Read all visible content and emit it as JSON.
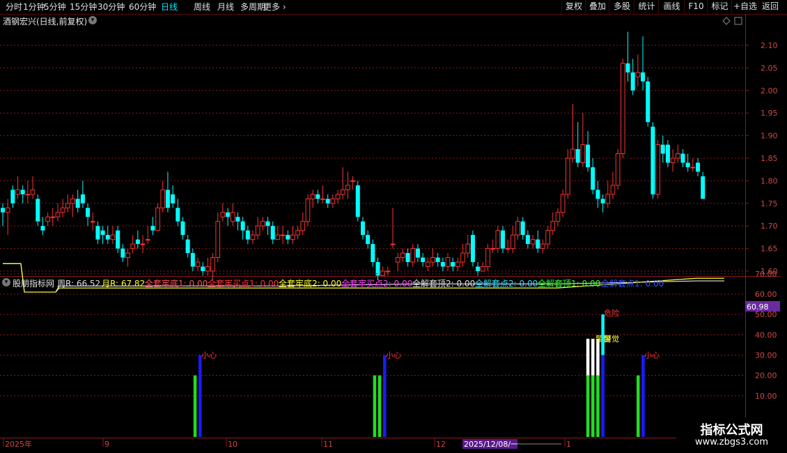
{
  "toolbar": {
    "timeframes": [
      "分时",
      "1分钟",
      "5分钟",
      "15分钟",
      "30分钟",
      "60分钟",
      "日线",
      "周线",
      "月线",
      "多周期",
      "更多"
    ],
    "active_timeframe": "日线",
    "right_buttons": [
      "复权",
      "叠加",
      "多股",
      "统计",
      "画线",
      "F10",
      "标记",
      "+自选",
      "返回"
    ]
  },
  "stock": {
    "title": "酒钢宏兴(日线,前复权)"
  },
  "price_axis": {
    "ticks": [
      "2.10",
      "2.05",
      "2.00",
      "1.95",
      "1.90",
      "1.85",
      "1.80",
      "1.75",
      "1.70",
      "1.65",
      "1.60"
    ]
  },
  "indicator": {
    "name": "股朋指标网",
    "items": [
      {
        "label": "周R: 66.52",
        "color": "#e0e0e0"
      },
      {
        "label": "月R: 67.82",
        "color": "#ffff33"
      },
      {
        "label": "全套牢底1: 0.00",
        "color": "#ff5555"
      },
      {
        "label": "全套牢买点1: 0.00",
        "color": "#ff3333"
      },
      {
        "label": "全套牢底2: 0.00",
        "color": "#ffff33"
      },
      {
        "label": "全套牢买点2: 0.00",
        "color": "#ff44ff"
      },
      {
        "label": "全解套顶2: 0.00",
        "color": "#e0e0e0"
      },
      {
        "label": "全解套点2: 0.00",
        "color": "#33ddff"
      },
      {
        "label": "全解套顶1: 0.00",
        "color": "#33ff33"
      },
      {
        "label": "全解套点1: 0.00",
        "color": "#3355ff"
      }
    ],
    "axis_ticks": [
      "70.00",
      "60.00",
      "50.00",
      "40.00",
      "30.00",
      "20.00",
      "10.00"
    ],
    "current_value": "60.98",
    "labels": {
      "careful": "小心",
      "danger": "危险",
      "alert": "警惕",
      "watch": "警觉"
    }
  },
  "date_axis": {
    "labels": [
      "2025年",
      "9",
      "10",
      "11",
      "12",
      "1"
    ],
    "cursor_date": "2025/12/08/一"
  },
  "watermark": {
    "logo": "指标公式网",
    "url": "www.zbgs3.com"
  },
  "colors": {
    "up": "#ff3333",
    "down": "#00ffff",
    "grid": "#8b1a1a",
    "bg": "#000000"
  },
  "chart_data": {
    "type": "candlestick",
    "price_range": [
      1.57,
      2.15
    ],
    "candles": [
      [
        1.74,
        1.73,
        1.75,
        1.7
      ],
      [
        1.73,
        1.74,
        1.76,
        1.68
      ],
      [
        1.78,
        1.75,
        1.79,
        1.74
      ],
      [
        1.77,
        1.78,
        1.81,
        1.76
      ],
      [
        1.78,
        1.77,
        1.79,
        1.75
      ],
      [
        1.77,
        1.77,
        1.8,
        1.75
      ],
      [
        1.77,
        1.78,
        1.81,
        1.76
      ],
      [
        1.76,
        1.71,
        1.77,
        1.7
      ],
      [
        1.7,
        1.69,
        1.72,
        1.68
      ],
      [
        1.71,
        1.72,
        1.73,
        1.7
      ],
      [
        1.72,
        1.72,
        1.74,
        1.7
      ],
      [
        1.72,
        1.73,
        1.75,
        1.71
      ],
      [
        1.73,
        1.74,
        1.76,
        1.72
      ],
      [
        1.74,
        1.75,
        1.77,
        1.73
      ],
      [
        1.75,
        1.76,
        1.77,
        1.72
      ],
      [
        1.76,
        1.74,
        1.78,
        1.73
      ],
      [
        1.77,
        1.75,
        1.8,
        1.74
      ],
      [
        1.74,
        1.72,
        1.75,
        1.7
      ],
      [
        1.71,
        1.71,
        1.73,
        1.69
      ],
      [
        1.7,
        1.67,
        1.71,
        1.66
      ],
      [
        1.69,
        1.68,
        1.7,
        1.66
      ],
      [
        1.68,
        1.67,
        1.7,
        1.66
      ],
      [
        1.67,
        1.68,
        1.7,
        1.66
      ],
      [
        1.69,
        1.65,
        1.7,
        1.64
      ],
      [
        1.65,
        1.63,
        1.66,
        1.62
      ],
      [
        1.63,
        1.64,
        1.65,
        1.61
      ],
      [
        1.65,
        1.66,
        1.68,
        1.64
      ],
      [
        1.67,
        1.66,
        1.69,
        1.65
      ],
      [
        1.66,
        1.66,
        1.68,
        1.64
      ],
      [
        1.67,
        1.67,
        1.7,
        1.66
      ],
      [
        1.7,
        1.69,
        1.72,
        1.68
      ],
      [
        1.69,
        1.74,
        1.75,
        1.69
      ],
      [
        1.74,
        1.78,
        1.8,
        1.73
      ],
      [
        1.78,
        1.74,
        1.82,
        1.73
      ],
      [
        1.77,
        1.75,
        1.79,
        1.74
      ],
      [
        1.74,
        1.71,
        1.76,
        1.7
      ],
      [
        1.71,
        1.68,
        1.72,
        1.67
      ],
      [
        1.67,
        1.64,
        1.68,
        1.63
      ],
      [
        1.64,
        1.61,
        1.65,
        1.6
      ],
      [
        1.61,
        1.62,
        1.63,
        1.6
      ],
      [
        1.61,
        1.6,
        1.62,
        1.59
      ],
      [
        1.6,
        1.61,
        1.63,
        1.59
      ],
      [
        1.6,
        1.63,
        1.64,
        1.58
      ],
      [
        1.63,
        1.71,
        1.73,
        1.62
      ],
      [
        1.72,
        1.73,
        1.75,
        1.71
      ],
      [
        1.73,
        1.72,
        1.74,
        1.7
      ],
      [
        1.71,
        1.73,
        1.75,
        1.7
      ],
      [
        1.72,
        1.71,
        1.73,
        1.69
      ],
      [
        1.71,
        1.69,
        1.72,
        1.67
      ],
      [
        1.69,
        1.67,
        1.7,
        1.66
      ],
      [
        1.67,
        1.68,
        1.69,
        1.66
      ],
      [
        1.68,
        1.7,
        1.72,
        1.67
      ],
      [
        1.7,
        1.71,
        1.72,
        1.69
      ],
      [
        1.71,
        1.7,
        1.72,
        1.68
      ],
      [
        1.7,
        1.67,
        1.71,
        1.66
      ],
      [
        1.67,
        1.68,
        1.7,
        1.67
      ],
      [
        1.68,
        1.68,
        1.7,
        1.66
      ],
      [
        1.68,
        1.67,
        1.69,
        1.66
      ],
      [
        1.67,
        1.68,
        1.7,
        1.66
      ],
      [
        1.68,
        1.69,
        1.7,
        1.67
      ],
      [
        1.69,
        1.71,
        1.73,
        1.68
      ],
      [
        1.71,
        1.76,
        1.77,
        1.7
      ],
      [
        1.76,
        1.77,
        1.78,
        1.74
      ],
      [
        1.77,
        1.76,
        1.78,
        1.75
      ],
      [
        1.76,
        1.76,
        1.79,
        1.75
      ],
      [
        1.76,
        1.75,
        1.77,
        1.74
      ],
      [
        1.75,
        1.76,
        1.77,
        1.74
      ],
      [
        1.76,
        1.77,
        1.78,
        1.75
      ],
      [
        1.77,
        1.78,
        1.83,
        1.76
      ],
      [
        1.78,
        1.79,
        1.82,
        1.76
      ],
      [
        1.8,
        1.8,
        1.81,
        1.78
      ],
      [
        1.79,
        1.72,
        1.8,
        1.71
      ],
      [
        1.71,
        1.68,
        1.72,
        1.67
      ],
      [
        1.68,
        1.66,
        1.69,
        1.65
      ],
      [
        1.66,
        1.62,
        1.67,
        1.61
      ],
      [
        1.62,
        1.59,
        1.63,
        1.58
      ],
      [
        1.59,
        1.6,
        1.61,
        1.59
      ],
      [
        1.6,
        1.6,
        1.61,
        1.59
      ],
      [
        1.66,
        1.66,
        1.74,
        1.65
      ],
      [
        1.62,
        1.63,
        1.64,
        1.6
      ],
      [
        1.63,
        1.64,
        1.65,
        1.62
      ],
      [
        1.64,
        1.62,
        1.65,
        1.61
      ],
      [
        1.62,
        1.65,
        1.66,
        1.61
      ],
      [
        1.65,
        1.63,
        1.66,
        1.62
      ],
      [
        1.63,
        1.62,
        1.64,
        1.61
      ],
      [
        1.61,
        1.62,
        1.63,
        1.6
      ],
      [
        1.62,
        1.63,
        1.65,
        1.61
      ],
      [
        1.63,
        1.62,
        1.64,
        1.61
      ],
      [
        1.62,
        1.61,
        1.63,
        1.6
      ],
      [
        1.61,
        1.63,
        1.64,
        1.6
      ],
      [
        1.62,
        1.61,
        1.63,
        1.6
      ],
      [
        1.61,
        1.62,
        1.63,
        1.6
      ],
      [
        1.62,
        1.64,
        1.66,
        1.61
      ],
      [
        1.64,
        1.66,
        1.68,
        1.63
      ],
      [
        1.68,
        1.62,
        1.69,
        1.61
      ],
      [
        1.61,
        1.6,
        1.62,
        1.59
      ],
      [
        1.6,
        1.61,
        1.62,
        1.6
      ],
      [
        1.61,
        1.65,
        1.66,
        1.6
      ],
      [
        1.65,
        1.65,
        1.67,
        1.64
      ],
      [
        1.65,
        1.69,
        1.7,
        1.64
      ],
      [
        1.69,
        1.65,
        1.7,
        1.64
      ],
      [
        1.65,
        1.65,
        1.67,
        1.64
      ],
      [
        1.65,
        1.68,
        1.7,
        1.64
      ],
      [
        1.68,
        1.71,
        1.72,
        1.67
      ],
      [
        1.71,
        1.68,
        1.72,
        1.67
      ],
      [
        1.68,
        1.66,
        1.69,
        1.65
      ],
      [
        1.66,
        1.67,
        1.68,
        1.65
      ],
      [
        1.67,
        1.65,
        1.69,
        1.64
      ],
      [
        1.65,
        1.66,
        1.67,
        1.64
      ],
      [
        1.66,
        1.69,
        1.7,
        1.65
      ],
      [
        1.69,
        1.71,
        1.73,
        1.68
      ],
      [
        1.71,
        1.73,
        1.74,
        1.7
      ],
      [
        1.73,
        1.77,
        1.78,
        1.72
      ],
      [
        1.77,
        1.85,
        1.87,
        1.76
      ],
      [
        1.85,
        1.87,
        1.97,
        1.84
      ],
      [
        1.87,
        1.84,
        1.93,
        1.83
      ],
      [
        1.84,
        1.88,
        1.95,
        1.83
      ],
      [
        1.88,
        1.83,
        1.91,
        1.82
      ],
      [
        1.83,
        1.78,
        1.85,
        1.77
      ],
      [
        1.78,
        1.76,
        1.8,
        1.74
      ],
      [
        1.76,
        1.75,
        1.77,
        1.73
      ],
      [
        1.75,
        1.77,
        1.8,
        1.74
      ],
      [
        1.77,
        1.79,
        1.82,
        1.76
      ],
      [
        1.79,
        1.86,
        1.87,
        1.78
      ],
      [
        1.86,
        2.06,
        2.07,
        1.85
      ],
      [
        2.06,
        2.04,
        2.13,
        2.02
      ],
      [
        2.04,
        2.0,
        2.07,
        1.99
      ],
      [
        2.03,
        2.04,
        2.08,
        2.01
      ],
      [
        2.04,
        2.02,
        2.12,
        2.0
      ],
      [
        2.02,
        1.93,
        2.03,
        1.92
      ],
      [
        1.92,
        1.77,
        1.93,
        1.76
      ],
      [
        1.77,
        1.88,
        1.89,
        1.76
      ],
      [
        1.88,
        1.86,
        1.9,
        1.84
      ],
      [
        1.88,
        1.84,
        1.89,
        1.83
      ],
      [
        1.84,
        1.85,
        1.87,
        1.82
      ],
      [
        1.85,
        1.86,
        1.88,
        1.84
      ],
      [
        1.86,
        1.84,
        1.87,
        1.83
      ],
      [
        1.84,
        1.83,
        1.86,
        1.82
      ],
      [
        1.83,
        1.83,
        1.85,
        1.82
      ],
      [
        1.84,
        1.82,
        1.85,
        1.81
      ],
      [
        1.81,
        1.76,
        1.82,
        1.76
      ]
    ],
    "indicator_lines": {
      "weekly_R": [
        75,
        75,
        75,
        75,
        61,
        61,
        61,
        61,
        61,
        61,
        61,
        64,
        64,
        64,
        64,
        64,
        64,
        65,
        65,
        66.5,
        66.5
      ],
      "monthly_R": [
        75,
        75,
        75,
        75,
        61,
        61,
        61,
        61,
        61,
        61,
        61,
        63,
        63,
        63,
        63,
        63,
        63,
        63,
        63,
        67.8,
        67.8
      ]
    },
    "signal_bars": [
      {
        "index": 38,
        "green": 20,
        "blue": null,
        "white": null,
        "label": null
      },
      {
        "index": 39,
        "green": null,
        "blue": 30,
        "white": null,
        "label": "careful"
      },
      {
        "index": 87,
        "green": 20,
        "blue": null,
        "white": null,
        "label": null
      },
      {
        "index": 88,
        "green": 20,
        "blue": null,
        "white": null,
        "label": null
      },
      {
        "index": 89,
        "green": null,
        "blue": 30,
        "white": null,
        "label": "careful"
      },
      {
        "index": 138,
        "green": 20,
        "blue": null,
        "white": 38,
        "label": null
      },
      {
        "index": 139,
        "green": 20,
        "blue": null,
        "white": 38,
        "label": null
      },
      {
        "index": 140,
        "green": 20,
        "blue": null,
        "white": 38,
        "label": "alert"
      },
      {
        "index": 141,
        "green": null,
        "blue": 30,
        "white": null,
        "cyan": 50,
        "label": "danger"
      },
      {
        "index": 150,
        "green": 20,
        "blue": null,
        "white": null,
        "label": null
      },
      {
        "index": 151,
        "green": null,
        "blue": 30,
        "white": null,
        "label": "careful"
      }
    ]
  }
}
